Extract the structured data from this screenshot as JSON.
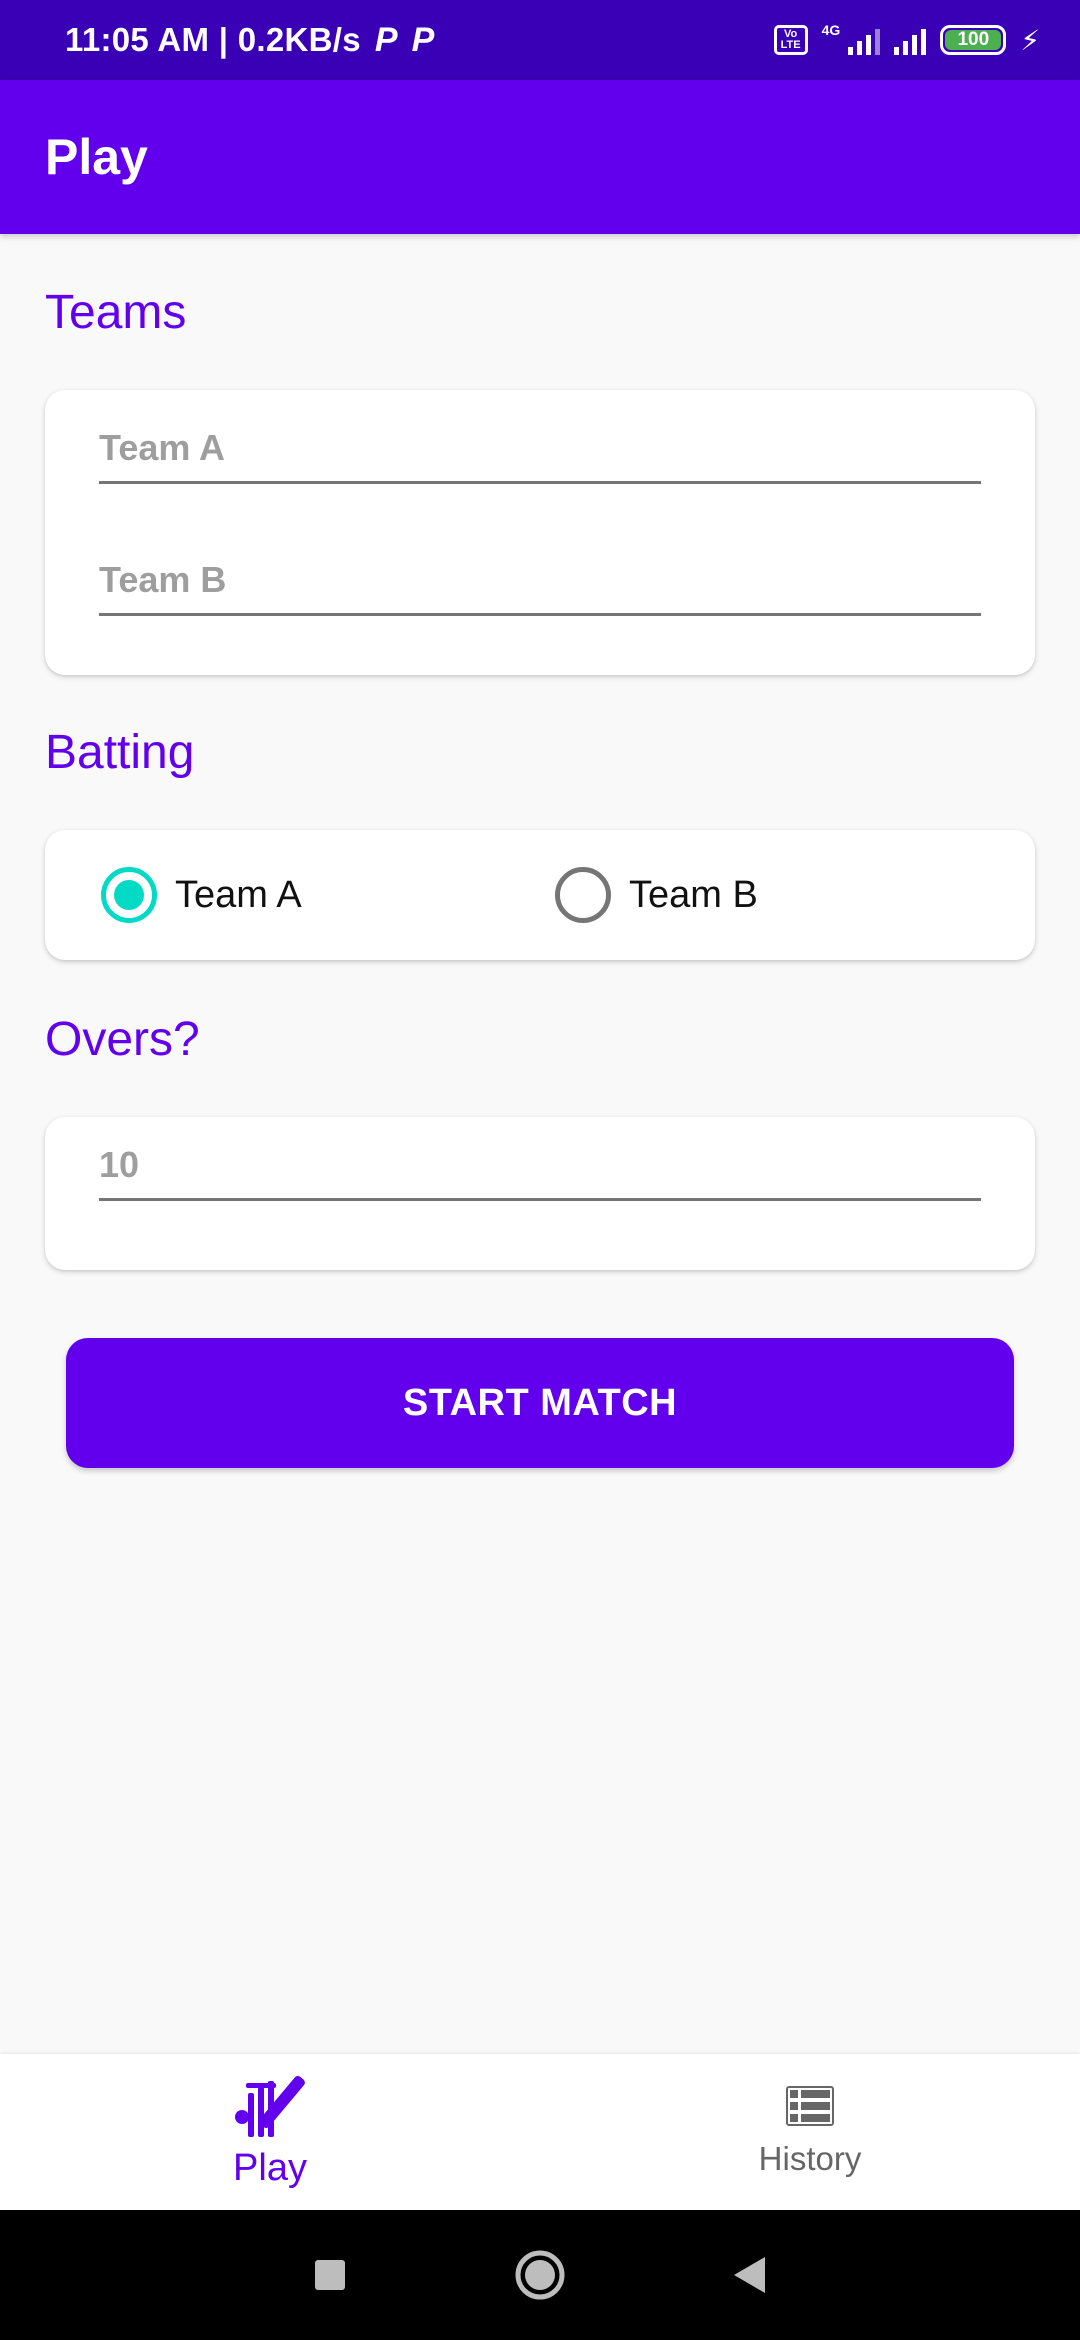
{
  "status_bar": {
    "time": "11:05 AM | 0.2KB/s",
    "p1": "P",
    "p2": "P",
    "volte": "Vo LTE",
    "network": "4G",
    "battery": "100"
  },
  "app_bar": {
    "title": "Play"
  },
  "teams": {
    "heading": "Teams",
    "team_a_placeholder": "Team A",
    "team_b_placeholder": "Team B"
  },
  "batting": {
    "heading": "Batting",
    "options": [
      {
        "label": "Team A",
        "checked": true
      },
      {
        "label": "Team B",
        "checked": false
      }
    ]
  },
  "overs": {
    "heading": "Overs?",
    "placeholder": "10"
  },
  "start_button": {
    "label": "START MATCH"
  },
  "bottom_nav": {
    "items": [
      {
        "label": "Play",
        "icon": "cricket-icon",
        "active": true
      },
      {
        "label": "History",
        "icon": "list-icon",
        "active": false
      }
    ]
  },
  "colors": {
    "primary": "#6200ee",
    "status_bar": "#3a00b6",
    "accent": "#03dac5"
  }
}
